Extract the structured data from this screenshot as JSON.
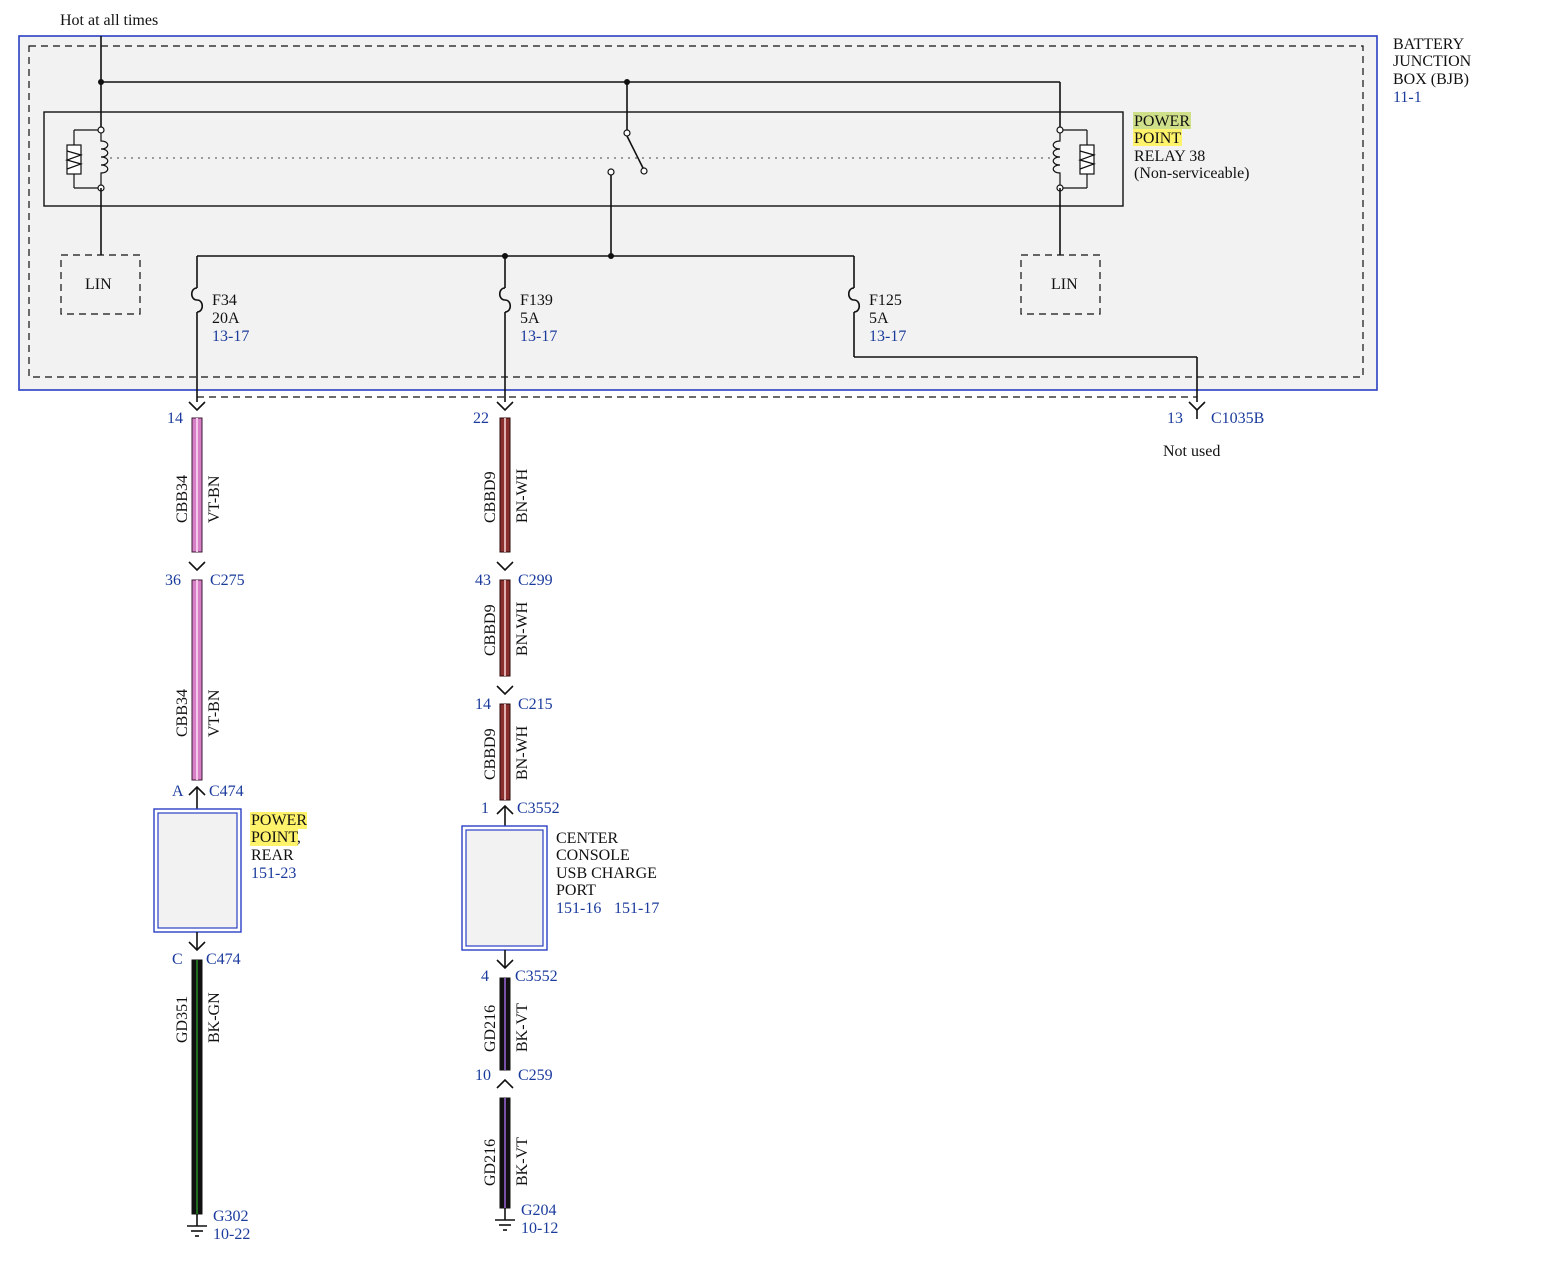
{
  "supply": {
    "label": "Hot at all times"
  },
  "bjb": {
    "title_lines": [
      "BATTERY",
      "JUNCTION",
      "BOX (BJB)"
    ],
    "ref": "11-1",
    "lin_left": "LIN",
    "lin_right": "LIN"
  },
  "relay": {
    "lines": [
      "POWER",
      "POINT",
      "RELAY 38",
      "(Non-serviceable)"
    ]
  },
  "fuses": [
    {
      "id": "F34",
      "rating": "20A",
      "ref": "13-17"
    },
    {
      "id": "F139",
      "rating": "5A",
      "ref": "13-17"
    },
    {
      "id": "F125",
      "rating": "5A",
      "ref": "13-17"
    }
  ],
  "unused_output": {
    "pin": "13",
    "connector": "C1035B",
    "note": "Not used"
  },
  "circuit_left": {
    "pin_top": "14",
    "wire1": {
      "circuit": "CBB34",
      "color_code": "VT-BN"
    },
    "conn1": {
      "pin": "36",
      "name": "C275"
    },
    "wire2": {
      "circuit": "CBB34",
      "color_code": "VT-BN"
    },
    "conn_in": {
      "pin": "A",
      "name": "C474"
    },
    "component": {
      "lines": [
        "POWER",
        "POINT,",
        "REAR"
      ],
      "ref": "151-23"
    },
    "conn_out": {
      "pin": "C",
      "name": "C474"
    },
    "wire3": {
      "circuit": "GD351",
      "color_code": "BK-GN"
    },
    "ground": {
      "name": "G302",
      "ref": "10-22"
    }
  },
  "circuit_center": {
    "pin_top": "22",
    "wire1": {
      "circuit": "CBBD9",
      "color_code": "BN-WH"
    },
    "conn1": {
      "pin": "43",
      "name": "C299"
    },
    "wire2": {
      "circuit": "CBBD9",
      "color_code": "BN-WH"
    },
    "conn2": {
      "pin": "14",
      "name": "C215"
    },
    "wire3": {
      "circuit": "CBBD9",
      "color_code": "BN-WH"
    },
    "conn_in": {
      "pin": "1",
      "name": "C3552"
    },
    "component": {
      "lines": [
        "CENTER",
        "CONSOLE",
        "USB CHARGE",
        "PORT"
      ],
      "ref1": "151-16",
      "ref2": "151-17"
    },
    "conn_out": {
      "pin": "4",
      "name": "C3552"
    },
    "wire4": {
      "circuit": "GD216",
      "color_code": "BK-VT"
    },
    "conn3": {
      "pin": "10",
      "name": "C259"
    },
    "wire5": {
      "circuit": "GD216",
      "color_code": "BK-VT"
    },
    "ground": {
      "name": "G204",
      "ref": "10-12"
    }
  },
  "colors": {
    "vt_bn": "#d77fc6",
    "bn_wh": "#8a2e2e",
    "bk_gn": "#1f3d1f",
    "bk_vt": "#2a1f3a",
    "box_border": "#2a3fc4",
    "ref_text": "#1a3a9c",
    "highlight": "#fff36b"
  }
}
